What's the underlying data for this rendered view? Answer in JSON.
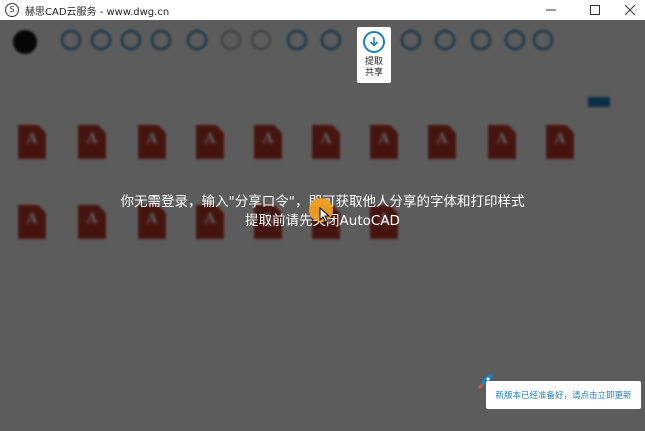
{
  "window": {
    "title": "赫思CAD云服务 - www.dwg.cn",
    "logo_text": "S",
    "minimize_label": "—",
    "maximize_label": "☐",
    "close_label": "✕"
  },
  "toolbar": {
    "highlight_label": "提取\n共享"
  },
  "guide": {
    "line1": "你无需登录，输入\"分享口令\"，即可获取他人分享的字体和打印样式",
    "line2": "提取前请先关闭AutoCAD"
  },
  "update_notice": "新版本已经准备好，请点击立即更新",
  "colors": {
    "accent": "#1f7fc4",
    "file_icon": "#c0392b",
    "cursor": "#f0a020"
  }
}
